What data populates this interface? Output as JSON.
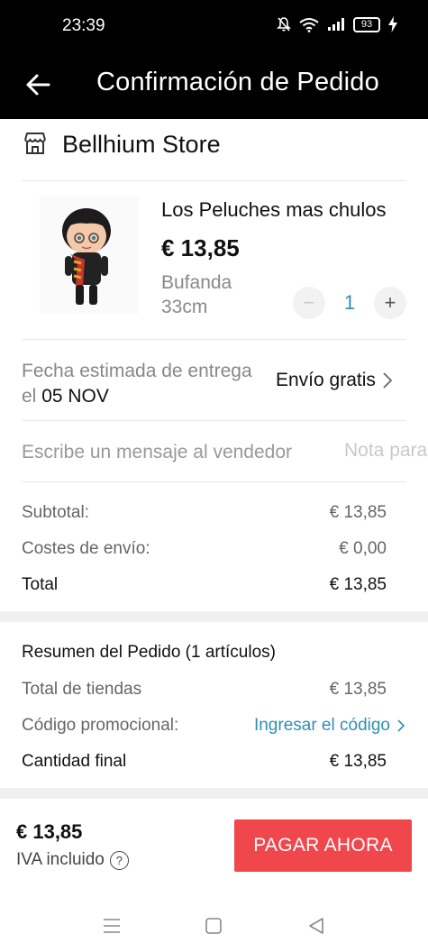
{
  "status_bar": {
    "time": "23:39",
    "battery": "93"
  },
  "header": {
    "title": "Confirmación de Pedido"
  },
  "store": {
    "name": "Bellhium Store"
  },
  "product": {
    "title": "Los Peluches mas chulos",
    "price": "€ 13,85",
    "variant": "Bufanda 33cm",
    "quantity": "1",
    "minus": "−",
    "plus": "+"
  },
  "delivery": {
    "label_prefix": "Fecha estimada de entrega el",
    "date": "05 NOV",
    "shipping": "Envío gratis"
  },
  "message": {
    "placeholder": "Escribe un mensaje al vendedor",
    "note": "Nota para el vendedor"
  },
  "totals": {
    "subtotal_label": "Subtotal:",
    "subtotal_value": "€ 13,85",
    "shipping_label": "Costes de envío:",
    "shipping_value": "€ 0,00",
    "total_label": "Total",
    "total_value": "€ 13,85"
  },
  "summary": {
    "title": "Resumen del Pedido (1 artículos)",
    "stores_label": "Total de tiendas",
    "stores_value": "€ 13,85",
    "promo_label": "Código promocional:",
    "promo_link": "Ingresar el código",
    "final_label": "Cantidad final",
    "final_value": "€ 13,85"
  },
  "footer": {
    "price": "€ 13,85",
    "tax_label": "IVA incluido",
    "help": "?",
    "pay_button": "PAGAR AHORA"
  },
  "colors": {
    "accent": "#f0474d",
    "link": "#2f8fb3",
    "header_bg": "#000000"
  }
}
